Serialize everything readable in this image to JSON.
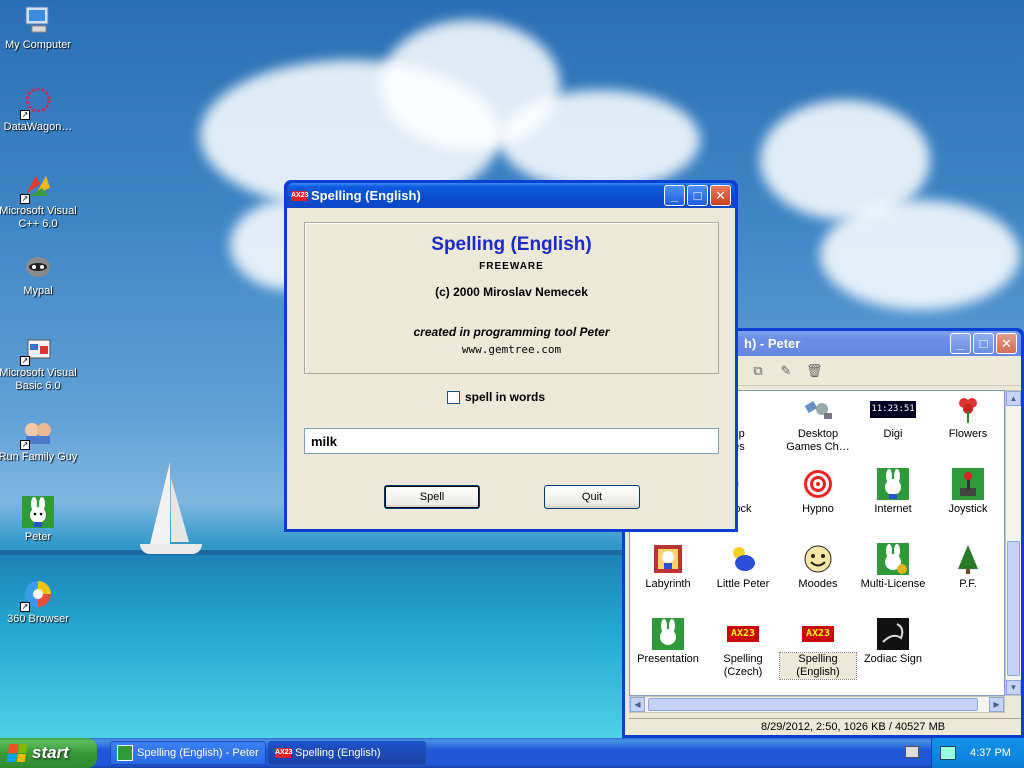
{
  "desktop_icons": [
    {
      "label": "My Computer",
      "icon": "computer-icon"
    },
    {
      "label": "DataWagon…",
      "icon": "datawagon-icon"
    },
    {
      "label": "Microsoft Visual C++ 6.0",
      "icon": "visual-cpp-icon"
    },
    {
      "label": "Mypal",
      "icon": "raccoon-icon"
    },
    {
      "label": "Microsoft Visual Basic 6.0",
      "icon": "visual-basic-icon"
    },
    {
      "label": "Run Family Guy",
      "icon": "family-guy-icon"
    },
    {
      "label": "Peter",
      "icon": "rabbit-icon"
    },
    {
      "label": "360 Browser",
      "icon": "browser-icon"
    }
  ],
  "spelling_window": {
    "title": "Spelling (English)",
    "app_badge": "AX23",
    "heading": "Spelling (English)",
    "freeware": "FREEWARE",
    "copyright": "(c) 2000 Miroslav Nemecek",
    "created": "created in programming tool Peter",
    "website": "www.gemtree.com",
    "checkbox_label": "spell in words",
    "checkbox_checked": false,
    "input_value": "milk",
    "spell_button": "Spell",
    "quit_button": "Quit"
  },
  "peter_window": {
    "title": "h) - Peter",
    "status": "8/29/2012, 2:50, 1026 KB / 40527 MB",
    "items": [
      {
        "label": "ktop\nmes",
        "icon": "desktop-games-icon"
      },
      {
        "label": "Desktop Games Ch…",
        "icon": "satellite-icon"
      },
      {
        "label": "Digi",
        "icon": "digital-clock-icon",
        "clock": "11:23:51"
      },
      {
        "label": "Flowers",
        "icon": "flower-icon"
      },
      {
        "label": "Clock",
        "icon": "clock-icon"
      },
      {
        "label": "Hypno",
        "icon": "spiral-icon"
      },
      {
        "label": "Internet",
        "icon": "rabbit-globe-icon"
      },
      {
        "label": "Joystick",
        "icon": "joystick-icon"
      },
      {
        "label": "Labyrinth",
        "icon": "labyrinth-icon"
      },
      {
        "label": "Little Peter",
        "icon": "pacifier-icon"
      },
      {
        "label": "Moodes",
        "icon": "smiley-icon"
      },
      {
        "label": "Multi-License",
        "icon": "rabbit-license-icon"
      },
      {
        "label": "P.F.",
        "icon": "tree-icon"
      },
      {
        "label": "Presentation",
        "icon": "rabbit-presentation-icon"
      },
      {
        "label": "Spelling (Czech)",
        "icon": "ax23-icon"
      },
      {
        "label": "Spelling (English)",
        "icon": "ax23-icon"
      },
      {
        "label": "Zodiac Sign",
        "icon": "scorpion-icon"
      }
    ]
  },
  "taskbar": {
    "start_label": "start",
    "tasks": [
      {
        "label": "Spelling (English) - Peter",
        "icon": "rabbit-icon"
      },
      {
        "label": "Spelling (English)",
        "icon": "ax23-icon"
      }
    ],
    "time": "4:37 PM"
  },
  "colors": {
    "title_blue": "#0a4ccd",
    "heading_blue": "#1c2bc8",
    "start_green": "#389a38"
  }
}
